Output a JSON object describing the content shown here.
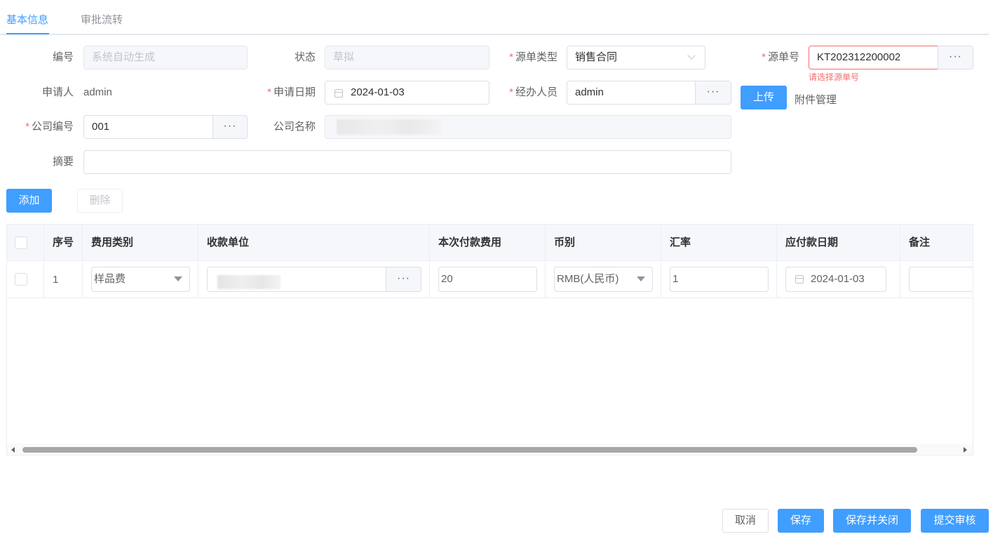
{
  "tabs": [
    {
      "label": "基本信息",
      "active": true
    },
    {
      "label": "审批流转",
      "active": false
    }
  ],
  "form": {
    "code": {
      "label": "编号",
      "placeholder": "系统自动生成"
    },
    "status": {
      "label": "状态",
      "value": "草拟"
    },
    "source_type": {
      "label": "源单类型",
      "value": "销售合同"
    },
    "source_no": {
      "label": "源单号",
      "value": "KT202312200002",
      "error": "请选择源单号",
      "button": "···"
    },
    "applicant": {
      "label": "申请人",
      "value": "admin"
    },
    "apply_date": {
      "label": "申请日期",
      "value": "2024-01-03"
    },
    "handler": {
      "label": "经办人员",
      "value": "admin",
      "button": "···"
    },
    "upload_label": "上传",
    "attachment_label": "附件管理",
    "company_code": {
      "label": "公司编号",
      "value": "001",
      "button": "···"
    },
    "company_name": {
      "label": "公司名称",
      "value": ""
    },
    "summary": {
      "label": "摘要",
      "value": ""
    },
    "required_mark": "*"
  },
  "table_actions": {
    "add": "添加",
    "delete": "删除"
  },
  "table": {
    "columns": [
      "序号",
      "费用类别",
      "收款单位",
      "本次付款费用",
      "币别",
      "汇率",
      "应付款日期",
      "备注"
    ],
    "rows": [
      {
        "index": "1",
        "fee_type": "样品费",
        "payee": "",
        "payee_button": "···",
        "amount": "20",
        "currency": "RMB(人民币)",
        "rate": "1",
        "due_date": "2024-01-03",
        "note": ""
      }
    ]
  },
  "footer": {
    "cancel": "取消",
    "save": "保存",
    "save_close": "保存并关闭",
    "submit": "提交审核"
  },
  "colors": {
    "primary": "#409eff",
    "error": "#f56c6c",
    "border": "#dcdfe6"
  }
}
